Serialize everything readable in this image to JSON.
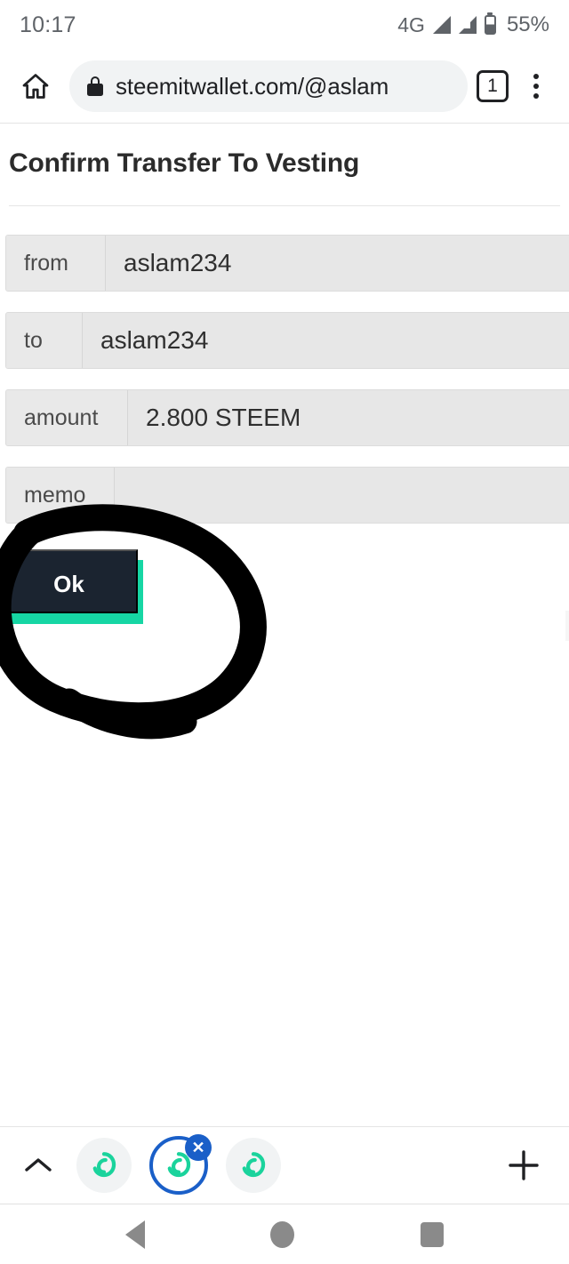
{
  "status_bar": {
    "time": "10:17",
    "network_label": "4G",
    "battery_percent": "55%",
    "icons": [
      "signal-icon",
      "signal-icon",
      "battery-icon"
    ]
  },
  "browser": {
    "home_icon": "home-icon",
    "lock_icon": "lock-icon",
    "url": "steemitwallet.com/@aslam",
    "tab_count": "1",
    "menu_icon": "overflow-menu-icon"
  },
  "page": {
    "title": "Confirm Transfer To Vesting",
    "rows": [
      {
        "label": "from",
        "value": "aslam234"
      },
      {
        "label": "to",
        "value": "aslam234"
      },
      {
        "label": "amount",
        "value": "2.800 STEEM"
      },
      {
        "label": "memo",
        "value": ""
      }
    ],
    "ok_button": "Ok"
  },
  "annotation": {
    "type": "hand-drawn-circle",
    "color": "#000000",
    "target": "ok-button"
  },
  "tab_strip": {
    "expand_icon": "chevron-up-icon",
    "new_tab_icon": "plus-icon",
    "close_icon": "close-icon",
    "tabs": [
      {
        "favicon": "steemit-logo-icon",
        "active": false
      },
      {
        "favicon": "steemit-logo-icon",
        "active": true
      },
      {
        "favicon": "steemit-logo-icon",
        "active": false
      }
    ]
  },
  "nav_bar": {
    "back_icon": "back-triangle-icon",
    "home_icon": "home-circle-icon",
    "recents_icon": "recents-square-icon"
  },
  "colors": {
    "accent_teal": "#16d6a4",
    "button_dark": "#1b2430",
    "tab_active_blue": "#1a5fc8",
    "field_gray": "#e7e7e7",
    "annotation_black": "#000000"
  }
}
